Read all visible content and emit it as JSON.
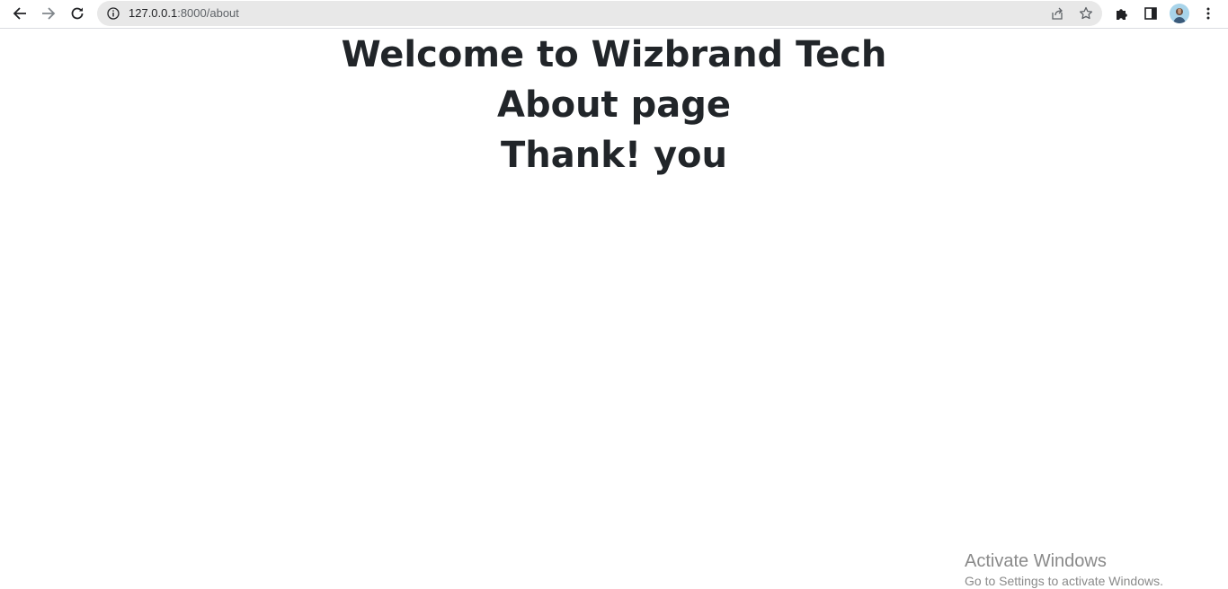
{
  "browser": {
    "address_bar": {
      "host": "127.0.0.1",
      "path": ":8000/about"
    },
    "icons": {
      "back": "back-arrow-icon",
      "forward": "forward-arrow-icon",
      "reload": "reload-icon",
      "site_info": "info-icon",
      "share": "share-icon",
      "bookmark": "star-icon",
      "extensions": "puzzle-icon",
      "side_panel": "side-panel-icon",
      "menu": "kebab-menu-icon",
      "profile": "avatar"
    }
  },
  "page": {
    "heading_1": "Welcome to Wizbrand Tech",
    "heading_2": "About page",
    "heading_3": "Thank! you"
  },
  "watermark": {
    "title": "Activate Windows",
    "subtitle": "Go to Settings to activate Windows."
  },
  "colors": {
    "text": "#212529",
    "omnibox": "#e8e8e8",
    "watermark": "#8a8a8a"
  }
}
